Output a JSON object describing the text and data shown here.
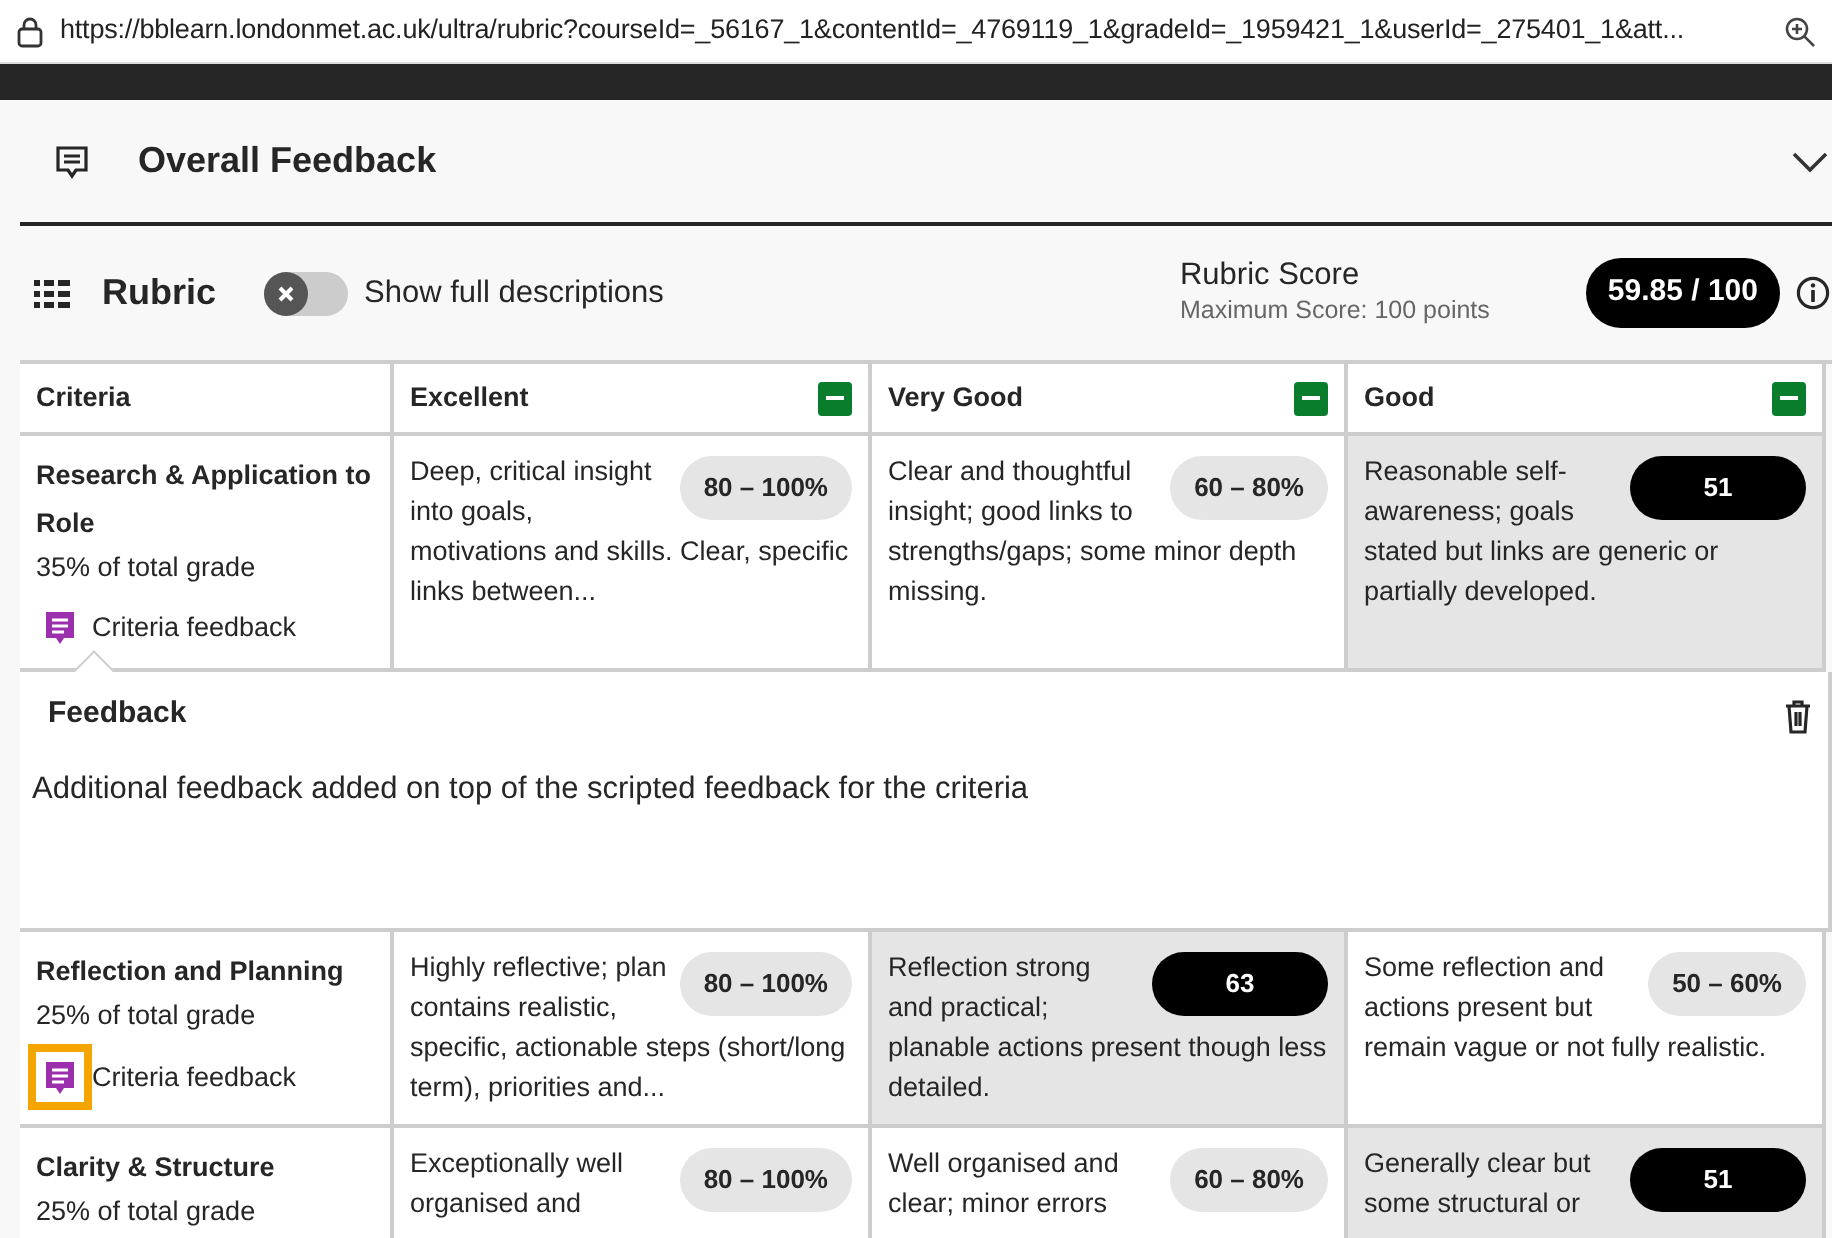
{
  "address_bar": {
    "url": "https://bblearn.londonmet.ac.uk/ultra/rubric?courseId=_56167_1&contentId=_4769119_1&gradeId=_1959421_1&userId=_275401_1&att..."
  },
  "overall_feedback": {
    "title": "Overall Feedback",
    "expanded": false
  },
  "rubric": {
    "title": "Rubric",
    "toggle": {
      "label": "Show full descriptions",
      "on": false
    },
    "score_title": "Rubric Score",
    "score_max": "Maximum Score: 100 points",
    "score": "59.85 / 100"
  },
  "grid": {
    "criteria_heading": "Criteria",
    "levels": [
      "Excellent",
      "Very Good",
      "Good"
    ],
    "criteria": [
      {
        "name": "Research & Application to Role",
        "weight": "35% of total grade",
        "feedback_link": "Criteria feedback",
        "focused": false,
        "cells": [
          {
            "text": "Deep, critical insight into goals, motivations and skills. Clear, specific links between...",
            "pill": "80 – 100%",
            "selected": false
          },
          {
            "text": "Clear and thoughtful insight; good links to strengths/gaps; some minor depth missing.",
            "pill": "60 – 80%",
            "selected": false
          },
          {
            "text": "Reasonable self-awareness; goals stated but links are generic or partially developed.",
            "pill": "51",
            "selected": true
          }
        ],
        "feedback": {
          "title": "Feedback",
          "text": "Additional feedback added on top of the scripted feedback for the criteria"
        }
      },
      {
        "name": "Reflection and Planning",
        "weight": "25% of total grade",
        "feedback_link": "Criteria feedback",
        "focused": true,
        "cells": [
          {
            "text": "Highly reflective; plan contains realistic, specific, actionable steps (short/long term), priorities and...",
            "pill": "80 – 100%",
            "selected": false
          },
          {
            "text": "Reflection strong and practical; planable actions present though less detailed.",
            "pill": "63",
            "selected": true
          },
          {
            "text": "Some reflection and actions present but remain vague or not fully realistic.",
            "pill": "50 – 60%",
            "selected": false
          }
        ]
      },
      {
        "name": "Clarity & Structure",
        "weight": "25% of total grade",
        "cells": [
          {
            "text": "Exceptionally well organised and",
            "pill": "80 – 100%",
            "selected": false
          },
          {
            "text": "Well organised and clear; minor errors",
            "pill": "60 – 80%",
            "selected": false
          },
          {
            "text": "Generally clear but some structural or",
            "pill": "51",
            "selected": true
          }
        ]
      }
    ]
  }
}
